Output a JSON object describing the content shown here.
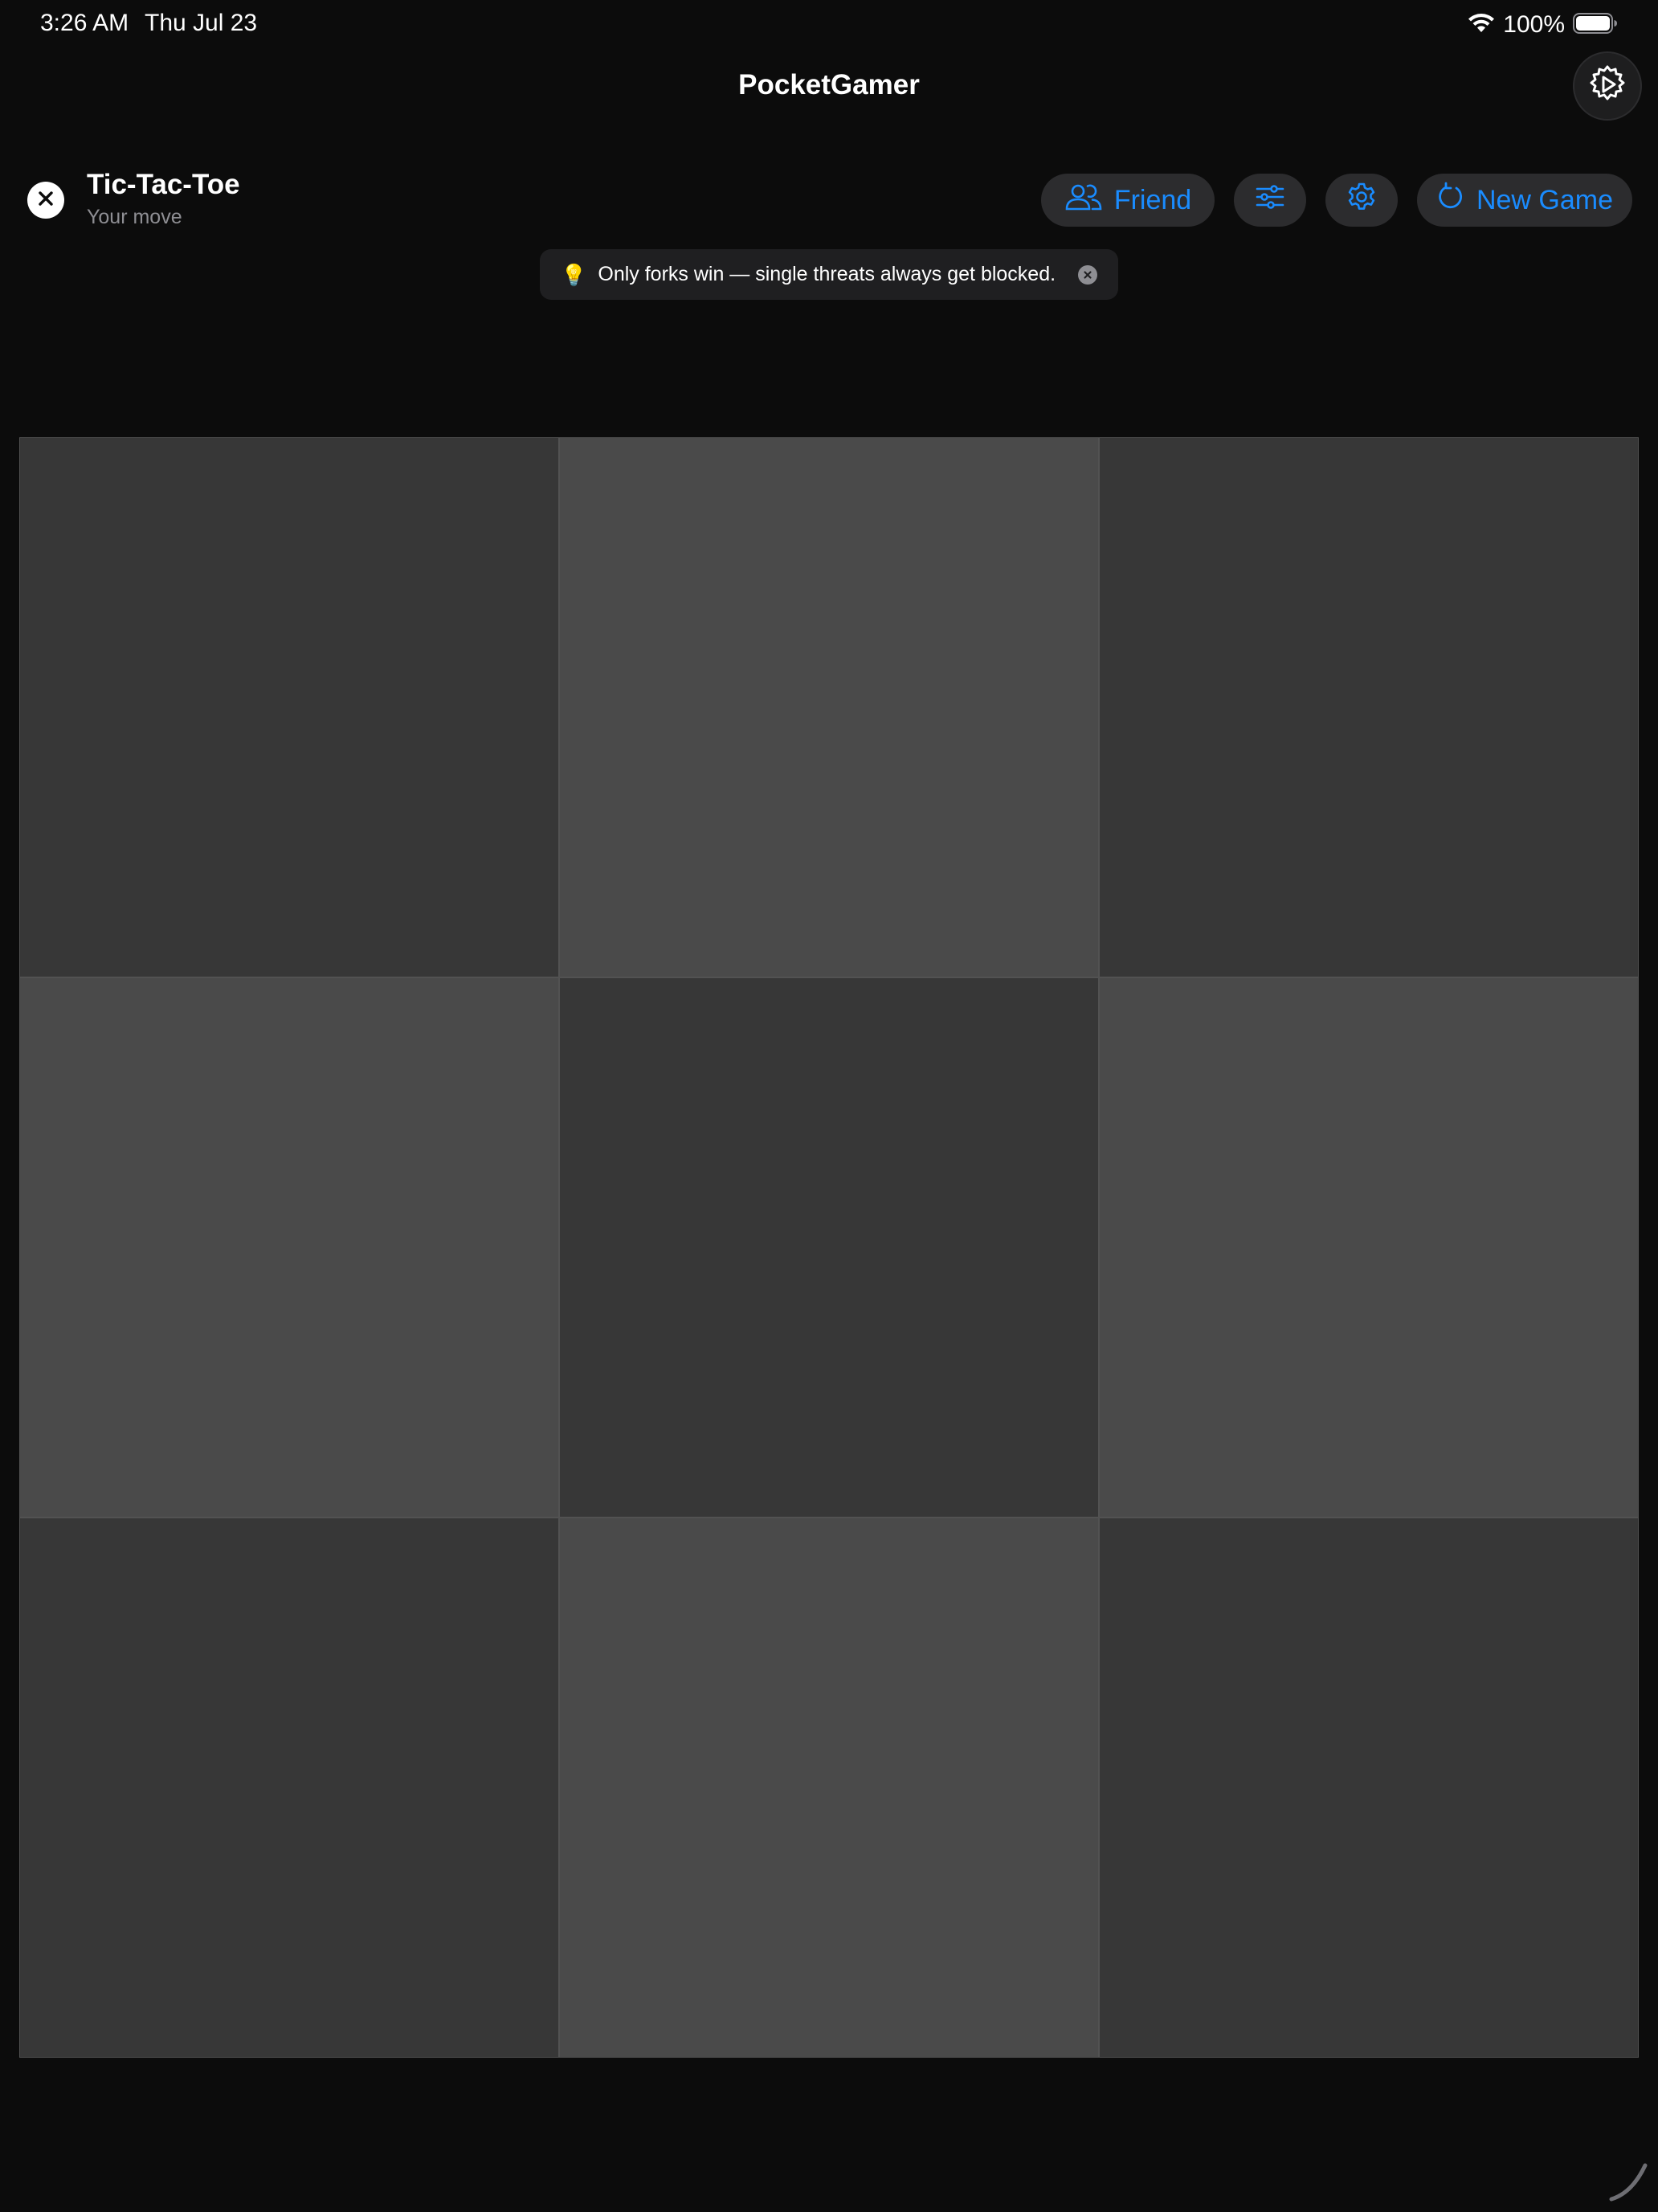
{
  "status_bar": {
    "time": "3:26 AM",
    "date": "Thu Jul 23",
    "battery": "100%"
  },
  "app": {
    "title": "PocketGamer"
  },
  "game": {
    "title": "Tic-Tac-Toe",
    "subtitle": "Your move"
  },
  "toolbar": {
    "friend_label": "Friend",
    "new_game_label": "New Game"
  },
  "tip": {
    "text": "Only forks win — single threats always get blocked."
  },
  "board": {
    "rows": 3,
    "cols": 3,
    "cells": [
      "",
      "",
      "",
      "",
      "",
      "",
      "",
      "",
      ""
    ]
  },
  "colors": {
    "accent": "#1a8cff",
    "background": "#0c0c0c",
    "cell_dark": "#373737",
    "cell_light": "#4a4a4a",
    "pill_background": "#2c2c2e",
    "subtitle": "#8e8e93",
    "bulb": "#ffcc00"
  },
  "icons": {
    "top_settings": "gear-play-icon",
    "close": "close-icon",
    "friend": "people-icon",
    "options": "sliders-icon",
    "settings": "gear-icon",
    "new_game": "refresh-icon",
    "tip": "lightbulb-icon",
    "tip_close": "close-circle-icon",
    "wifi": "wifi-icon",
    "battery": "battery-icon"
  }
}
